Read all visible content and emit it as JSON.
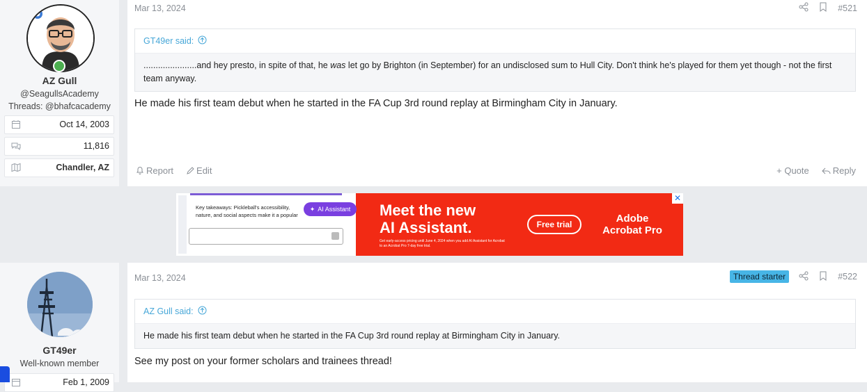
{
  "post1": {
    "user": {
      "name": "AZ Gull",
      "title_line1": "@SeagullsAcademy",
      "title_line2": "Threads: @bhafcacademy",
      "joined": "Oct 14, 2003",
      "messages": "11,816",
      "location": "Chandler, AZ"
    },
    "date": "Mar 13, 2024",
    "number": "#521",
    "quote": {
      "author": "GT49er said:",
      "text_before": "......................and hey presto, in spite of that, he ",
      "text_em": "was",
      "text_after": " let go by Brighton (in September) for an undisclosed sum to Hull City. Don't think he's played for them yet though - not the first team anyway."
    },
    "message": "He made his first team debut when he started in the FA Cup 3rd round replay at Birmingham City in January.",
    "actions": {
      "report": "Report",
      "edit": "Edit",
      "quote": "+ Quote",
      "reply": "Reply"
    }
  },
  "ad": {
    "snippet_text": "Key takeaways: Pickleball's accessibility, nature, and social aspects make it a popular",
    "chip": "AI Assistant",
    "headline_1": "Meet the new",
    "headline_2": "AI Assistant.",
    "fine_print": "Get early-access pricing until June 4, 2024 when you add AI Assistant for Acrobat to an Acrobat Pro 7-day free trial.",
    "cta": "Free trial",
    "brand_1": "Adobe",
    "brand_2": "Acrobat Pro",
    "close": "✕"
  },
  "post2": {
    "user": {
      "name": "GT49er",
      "title": "Well-known member",
      "joined": "Feb 1, 2009"
    },
    "date": "Mar 13, 2024",
    "badge": "Thread starter",
    "number": "#522",
    "quote": {
      "author": "AZ Gull said:",
      "text": "He made his first team debut when he started in the FA Cup 3rd round replay at Birmingham City in January."
    },
    "message": "See my post on your former scholars and trainees thread!"
  },
  "colors": {
    "accent": "#47a7d8",
    "badge": "#47b5e6",
    "ad_red": "#f22a14",
    "muted": "#8a8f96"
  }
}
